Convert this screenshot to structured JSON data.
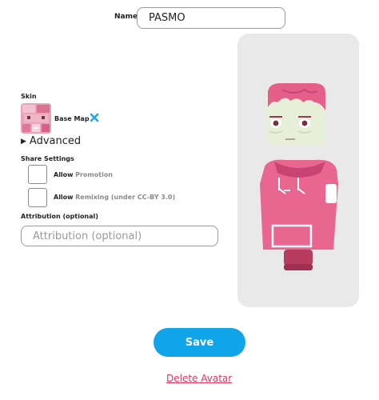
{
  "name": {
    "label": "Name",
    "value": "PASMO"
  },
  "skin": {
    "label": "Skin",
    "thumbnail_icon": "pink-skin-texture-thumbnail",
    "name": "Base Map",
    "remove_icon": "close-icon",
    "remove_color": "#1ea7e1"
  },
  "advanced": {
    "label": "Advanced"
  },
  "share": {
    "label": "Share Settings",
    "promotion": {
      "allow": "Allow",
      "label": "Promotion",
      "checked": false
    },
    "remixing": {
      "allow": "Allow",
      "label": "Remixing (under CC-BY 3.0)",
      "checked": false
    }
  },
  "attribution": {
    "label": "Attribution (optional)",
    "placeholder": "Attribution (optional)",
    "value": ""
  },
  "preview": {
    "icon": "avatar-3d-preview",
    "skin_color": "#e8668f",
    "face_color": "#e6efd8",
    "hair_color": "#e05a86"
  },
  "actions": {
    "save_label": "Save",
    "delete_label": "Delete Avatar"
  },
  "colors": {
    "accent": "#10a4e8",
    "danger": "#e2345a"
  }
}
